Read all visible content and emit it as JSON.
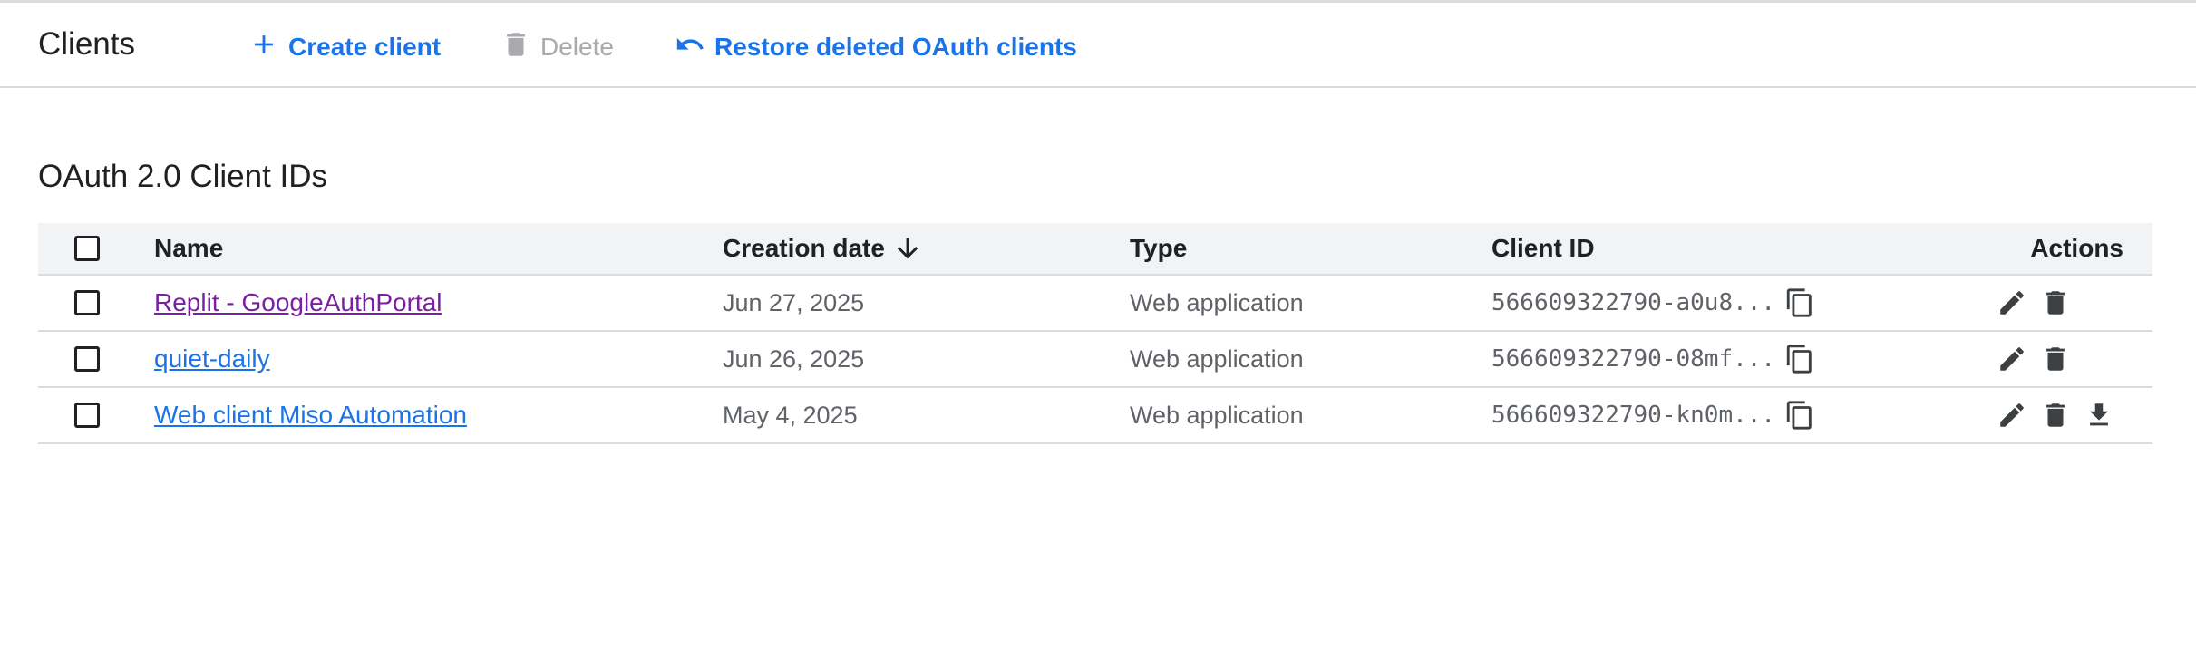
{
  "header": {
    "title": "Clients",
    "create_label": "Create client",
    "delete_label": "Delete",
    "restore_label": "Restore deleted OAuth clients"
  },
  "section": {
    "title": "OAuth 2.0 Client IDs"
  },
  "table": {
    "columns": {
      "name": "Name",
      "creation_date": "Creation date",
      "type": "Type",
      "client_id": "Client ID",
      "actions": "Actions"
    },
    "rows": [
      {
        "name": "Replit - GoogleAuthPortal",
        "date": "Jun 27, 2025",
        "type": "Web application",
        "client_id": "566609322790-a0u8..."
      },
      {
        "name": "quiet-daily",
        "date": "Jun 26, 2025",
        "type": "Web application",
        "client_id": "566609322790-08mf..."
      },
      {
        "name": "Web client Miso Automation",
        "date": "May 4, 2025",
        "type": "Web application",
        "client_id": "566609322790-kn0m..."
      }
    ]
  },
  "colors": {
    "accent": "#1a73e8",
    "visited_link": "#7b1fa2",
    "disabled": "#a8aaad",
    "header_bg": "#f1f3f4"
  }
}
